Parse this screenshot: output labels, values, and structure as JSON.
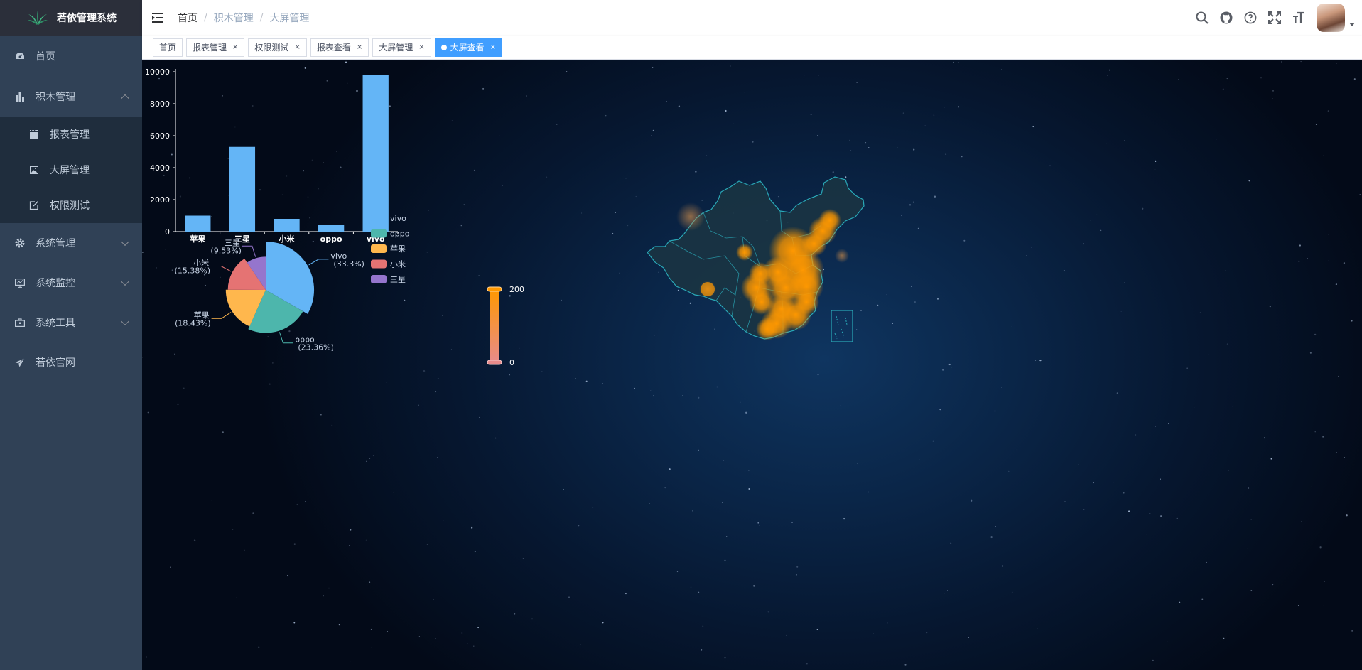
{
  "app": {
    "title": "若依管理系统"
  },
  "sidebar": {
    "items": [
      {
        "label": "首页",
        "icon": "dashboard-icon"
      },
      {
        "label": "积木管理",
        "icon": "chart-icon",
        "expanded": true,
        "children": [
          {
            "label": "报表管理",
            "icon": "clapper-icon"
          },
          {
            "label": "大屏管理",
            "icon": "image-icon"
          },
          {
            "label": "权限测试",
            "icon": "edit-icon"
          }
        ]
      },
      {
        "label": "系统管理",
        "icon": "gear-icon"
      },
      {
        "label": "系统监控",
        "icon": "monitor-icon"
      },
      {
        "label": "系统工具",
        "icon": "toolbox-icon"
      },
      {
        "label": "若依官网",
        "icon": "send-icon"
      }
    ]
  },
  "breadcrumb": [
    "首页",
    "积木管理",
    "大屏管理"
  ],
  "tags": [
    {
      "label": "首页",
      "closable": false,
      "active": false
    },
    {
      "label": "报表管理",
      "closable": true,
      "active": false
    },
    {
      "label": "权限测试",
      "closable": true,
      "active": false
    },
    {
      "label": "报表查看",
      "closable": true,
      "active": false
    },
    {
      "label": "大屏管理",
      "closable": true,
      "active": false
    },
    {
      "label": "大屏查看",
      "closable": true,
      "active": true
    }
  ],
  "colors": {
    "sidebar_bg": "#304156",
    "active_tag": "#409eff",
    "bar": "#64b5f6",
    "heat": "#ff9800"
  },
  "chart_data": [
    {
      "type": "bar",
      "categories": [
        "苹果",
        "三星",
        "小米",
        "oppo",
        "vivo"
      ],
      "values": [
        1000,
        5300,
        800,
        400,
        9800
      ],
      "ylim": [
        0,
        10000
      ],
      "yticks": [
        0,
        2000,
        4000,
        6000,
        8000,
        10000
      ],
      "color": "#64b5f6"
    },
    {
      "type": "pie",
      "rose": true,
      "slices": [
        {
          "name": "vivo",
          "label": "vivo",
          "percent": "(33.3%)",
          "value": 33.3,
          "color": "#64b5f6"
        },
        {
          "name": "oppo",
          "label": "oppo",
          "percent": "(23.36%)",
          "value": 23.36,
          "color": "#4db6ac"
        },
        {
          "name": "苹果",
          "label": "苹果",
          "percent": "(18.43%)",
          "value": 18.43,
          "color": "#ffb74d"
        },
        {
          "name": "小米",
          "label": "小米",
          "percent": "(15.38%)",
          "value": 15.38,
          "color": "#e57373"
        },
        {
          "name": "三星",
          "label": "三星",
          "percent": "(9.53%)",
          "value": 9.53,
          "color": "#9575cd"
        }
      ],
      "legend": [
        "vivo",
        "oppo",
        "苹果",
        "小米",
        "三星"
      ]
    },
    {
      "type": "heatmap",
      "map": "china",
      "visual_map": {
        "min": 0,
        "max": 200,
        "min_label": "0",
        "max_label": "200"
      },
      "color": "#ff9800"
    }
  ]
}
